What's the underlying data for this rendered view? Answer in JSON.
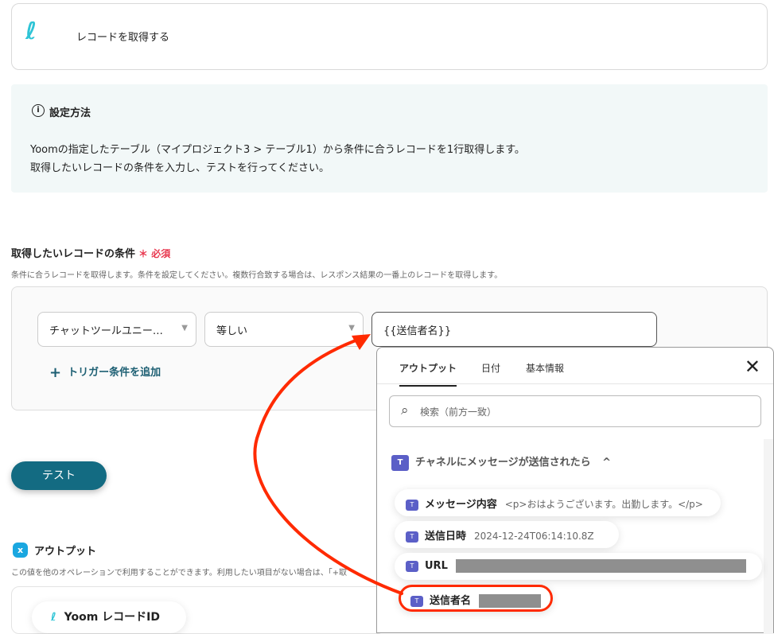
{
  "header": {
    "title": "レコードを取得する"
  },
  "info": {
    "heading": "設定方法",
    "line1": "Yoomの指定したテーブル（マイプロジェクト3 > テーブル1）から条件に合うレコードを1行取得します。",
    "line2": "取得したいレコードの条件を入力し、テストを行ってください。"
  },
  "conditions": {
    "heading": "取得したいレコードの条件",
    "required_mark": "＊",
    "required": "必須",
    "description": "条件に合うレコードを取得します。条件を設定してください。複数行合致する場合は、レスポンス結果の一番上のレコードを取得します。",
    "field": "チャットツールユニー…",
    "operator": "等しい",
    "value": "{{送信者名}}",
    "add_label": "トリガー条件を追加"
  },
  "test_button": "テスト",
  "output": {
    "heading": "アウトプット",
    "description": "この値を他のオペレーションで利用することができます。利用したい項目がない場合は、「+取",
    "item": "Yoom レコードID"
  },
  "panel": {
    "tabs": [
      "アウトプット",
      "日付",
      "基本情報"
    ],
    "search_placeholder": "検索（前方一致）",
    "group": "チャネルにメッセージが送信されたら",
    "items": [
      {
        "label": "メッセージ内容",
        "value": "<p>おはようございます。出勤します。</p>"
      },
      {
        "label": "送信日時",
        "value": "2024-12-24T06:14:10.8Z"
      },
      {
        "label": "URL",
        "value": ""
      },
      {
        "label": "送信者名",
        "value": ""
      }
    ]
  },
  "colors": {
    "accent": "#136b82",
    "required": "#e8384f",
    "annotation": "#ff2a00"
  }
}
